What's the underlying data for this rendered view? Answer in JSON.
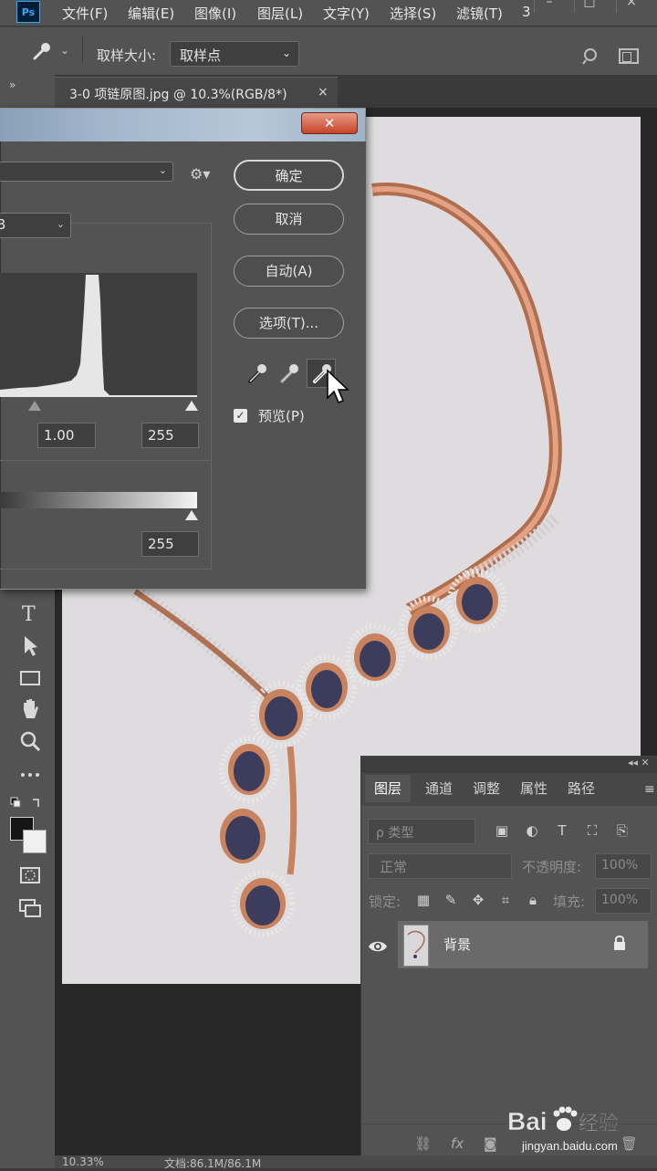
{
  "app": {
    "logo": "Ps",
    "menu": [
      "文件(F)",
      "编辑(E)",
      "图像(I)",
      "图层(L)",
      "文字(Y)",
      "选择(S)",
      "滤镜(T)",
      "3"
    ]
  },
  "options_bar": {
    "sample_size_label": "取样大小:",
    "sample_size_value": "取样点"
  },
  "document": {
    "tab_title": "3-0 项链原图.jpg @ 10.3%(RGB/8*)",
    "close_glyph": "×"
  },
  "levels_dialog": {
    "close_glyph": "✕",
    "channel_visible": "B",
    "buttons": {
      "ok": "确定",
      "cancel": "取消",
      "auto": "自动(A)",
      "options": "选项(T)..."
    },
    "input_gamma": "1.00",
    "input_white": "255",
    "output_white": "255",
    "preview_label": "预览(P)",
    "preview_checked": true
  },
  "layers_panel": {
    "tabs": [
      "图层",
      "通道",
      "调整",
      "属性",
      "路径"
    ],
    "active_tab": "图层",
    "filter_placeholder": "ρ 类型",
    "blend_mode": "正常",
    "opacity_label": "不透明度:",
    "opacity_value": "100%",
    "lock_label": "锁定:",
    "fill_label": "填充:",
    "fill_value": "100%",
    "layers": [
      {
        "name": "背景",
        "visible": true,
        "locked": true
      }
    ]
  },
  "status_bar": {
    "zoom": "10.33%",
    "doc_info": "文档:86.1M/86.1M"
  },
  "watermark": {
    "brand": "Bai du 经验",
    "url": "jingyan.baidu.com"
  },
  "colors": {
    "ui_dark": "#535353",
    "canvas_bg": "#dedcde",
    "necklace_gold": "#c8825e",
    "gem": "#3c3c5c",
    "close_red": "#c7442a"
  }
}
